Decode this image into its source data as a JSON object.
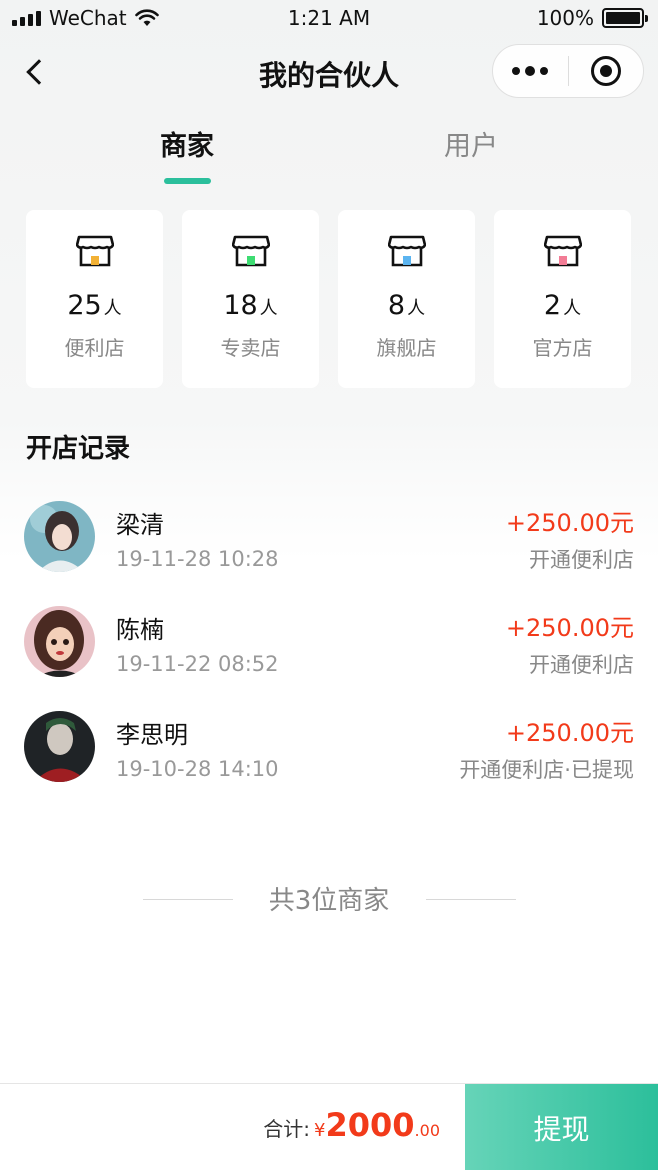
{
  "status_bar": {
    "carrier": "WeChat",
    "time": "1:21 AM",
    "battery": "100%"
  },
  "nav": {
    "title": "我的合伙人"
  },
  "tabs": [
    {
      "label": "商家",
      "active": true
    },
    {
      "label": "用户",
      "active": false
    }
  ],
  "colors": {
    "accent": "#2bbf9c",
    "amount": "#f23a1a",
    "icon_yellow": "#f2b135",
    "icon_green": "#3ddc72",
    "icon_blue": "#5bb4f0",
    "icon_pink": "#f27c95"
  },
  "store_types": [
    {
      "count": "25",
      "unit": "人",
      "label": "便利店",
      "icon": "store-icon"
    },
    {
      "count": "18",
      "unit": "人",
      "label": "专卖店",
      "icon": "store-icon"
    },
    {
      "count": "8",
      "unit": "人",
      "label": "旗舰店",
      "icon": "store-icon"
    },
    {
      "count": "2",
      "unit": "人",
      "label": "官方店",
      "icon": "store-icon"
    }
  ],
  "section_title": "开店记录",
  "records": [
    {
      "name": "梁清",
      "date": "19-11-28 10:28",
      "amount": "+250.00元",
      "desc": "开通便利店"
    },
    {
      "name": "陈楠",
      "date": "19-11-22 08:52",
      "amount": "+250.00元",
      "desc": "开通便利店"
    },
    {
      "name": "李思明",
      "date": "19-10-28 14:10",
      "amount": "+250.00元",
      "desc": "开通便利店·已提现"
    }
  ],
  "summary": "共3位商家",
  "bottom_bar": {
    "total_label": "合计:",
    "currency": "¥",
    "amount_int": "2000",
    "amount_dec": ".00",
    "button_label": "提现"
  }
}
